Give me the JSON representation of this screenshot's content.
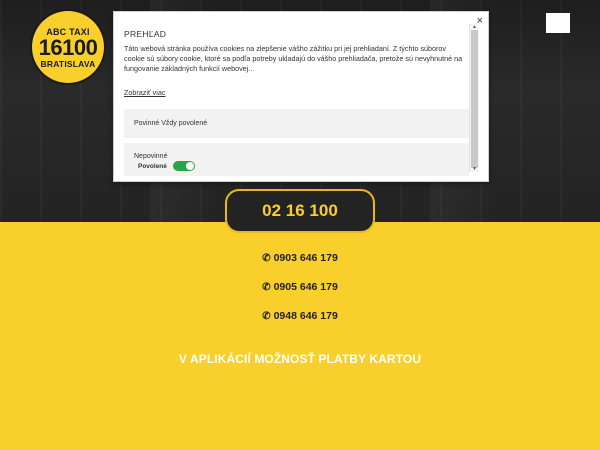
{
  "logo": {
    "line1": "ABC TAXI",
    "line2": "16100",
    "line3": "BRATISLAVA"
  },
  "main_phone": "02 16 100",
  "phones": [
    "0903 646 179",
    "0905 646 179",
    "0948 646 179"
  ],
  "promo": "V APLIKÁCIÍ MOŽNOSŤ PLATBY KARTOU",
  "cookie_modal": {
    "close": "×",
    "title": "PREHĽAD",
    "body": "Táto webová stránka používa cookies na zlepšenie vášho zážitku pri jej prehliadaní. Z týchto súborov cookie sú súbory cookie, ktoré sa podľa potreby ukladajú do vášho prehliadača, pretože sú nevyhnutné na fungovanie základných funkcií webovej...",
    "more_link": "Zobraziť viac",
    "categories": [
      {
        "name": "Povinné",
        "status": "Vždy povolené"
      },
      {
        "name": "Nepovinné",
        "status": "Povolené",
        "enabled": true
      }
    ]
  },
  "colors": {
    "brand_yellow": "#f9cf2b",
    "dark": "#232323",
    "toggle_on": "#26a64a"
  },
  "icons": {
    "phone": "phone-icon",
    "menu": "hamburger-menu-icon",
    "close": "close-icon"
  }
}
